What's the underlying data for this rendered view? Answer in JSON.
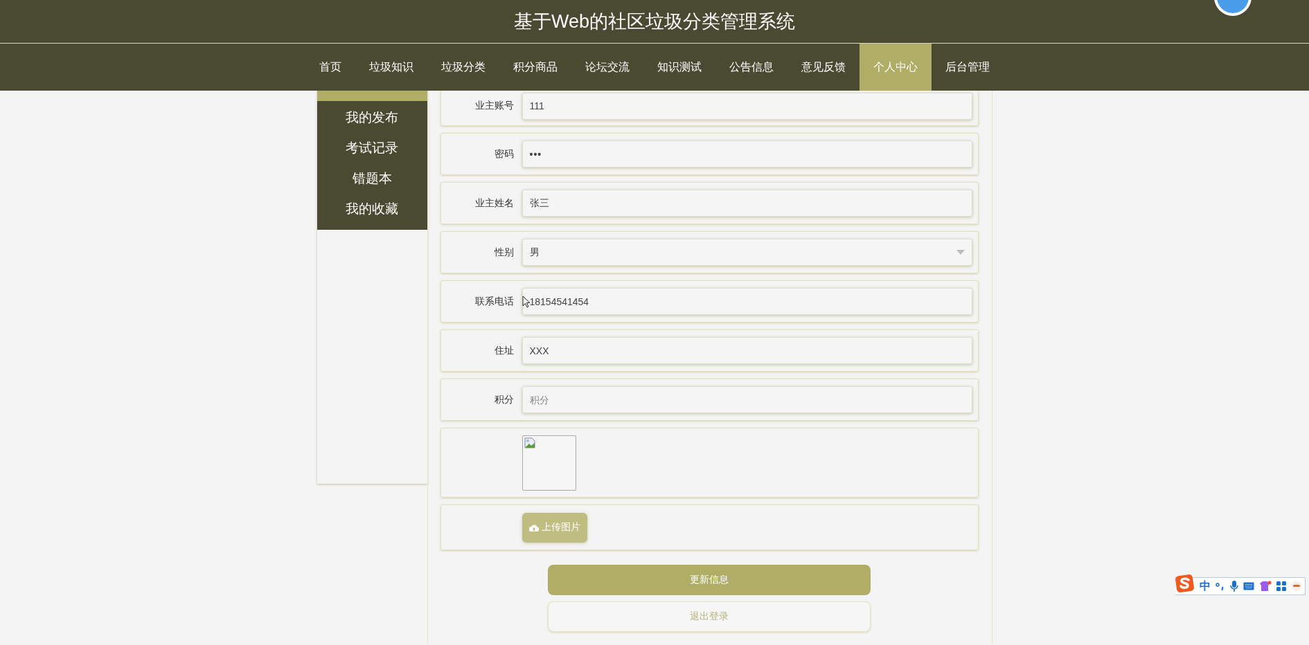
{
  "header": {
    "title": "基于Web的社区垃圾分类管理系统"
  },
  "nav": [
    {
      "label": "首页",
      "selected": false
    },
    {
      "label": "垃圾知识",
      "selected": false
    },
    {
      "label": "垃圾分类",
      "selected": false
    },
    {
      "label": "积分商品",
      "selected": false
    },
    {
      "label": "论坛交流",
      "selected": false
    },
    {
      "label": "知识测试",
      "selected": false
    },
    {
      "label": "公告信息",
      "selected": false
    },
    {
      "label": "意见反馈",
      "selected": false
    },
    {
      "label": "个人中心",
      "selected": true
    },
    {
      "label": "后台管理",
      "selected": false
    }
  ],
  "sidebar": {
    "items": [
      {
        "label": "我的发布",
        "selected": false
      },
      {
        "label": "考试记录",
        "selected": false
      },
      {
        "label": "错题本",
        "selected": false
      },
      {
        "label": "我的收藏",
        "selected": false
      }
    ]
  },
  "form": {
    "fields": [
      {
        "label": "业主账号",
        "kind": "text",
        "value": "111"
      },
      {
        "label": "密码",
        "kind": "password",
        "value": "•••"
      },
      {
        "label": "业主姓名",
        "kind": "text",
        "value": "张三"
      },
      {
        "label": "性别",
        "kind": "select",
        "value": "男"
      },
      {
        "label": "联系电话",
        "kind": "text",
        "value": "18154541454"
      },
      {
        "label": "住址",
        "kind": "text",
        "value": "XXX"
      },
      {
        "label": "积分",
        "kind": "text",
        "placeholder": "积分"
      }
    ],
    "upload_button": "上传图片",
    "buttons": [
      {
        "label": "更新信息",
        "kind": "primary"
      },
      {
        "label": "退出登录",
        "kind": "secondary"
      }
    ]
  },
  "ime_toolbar": {
    "mode": "中"
  }
}
